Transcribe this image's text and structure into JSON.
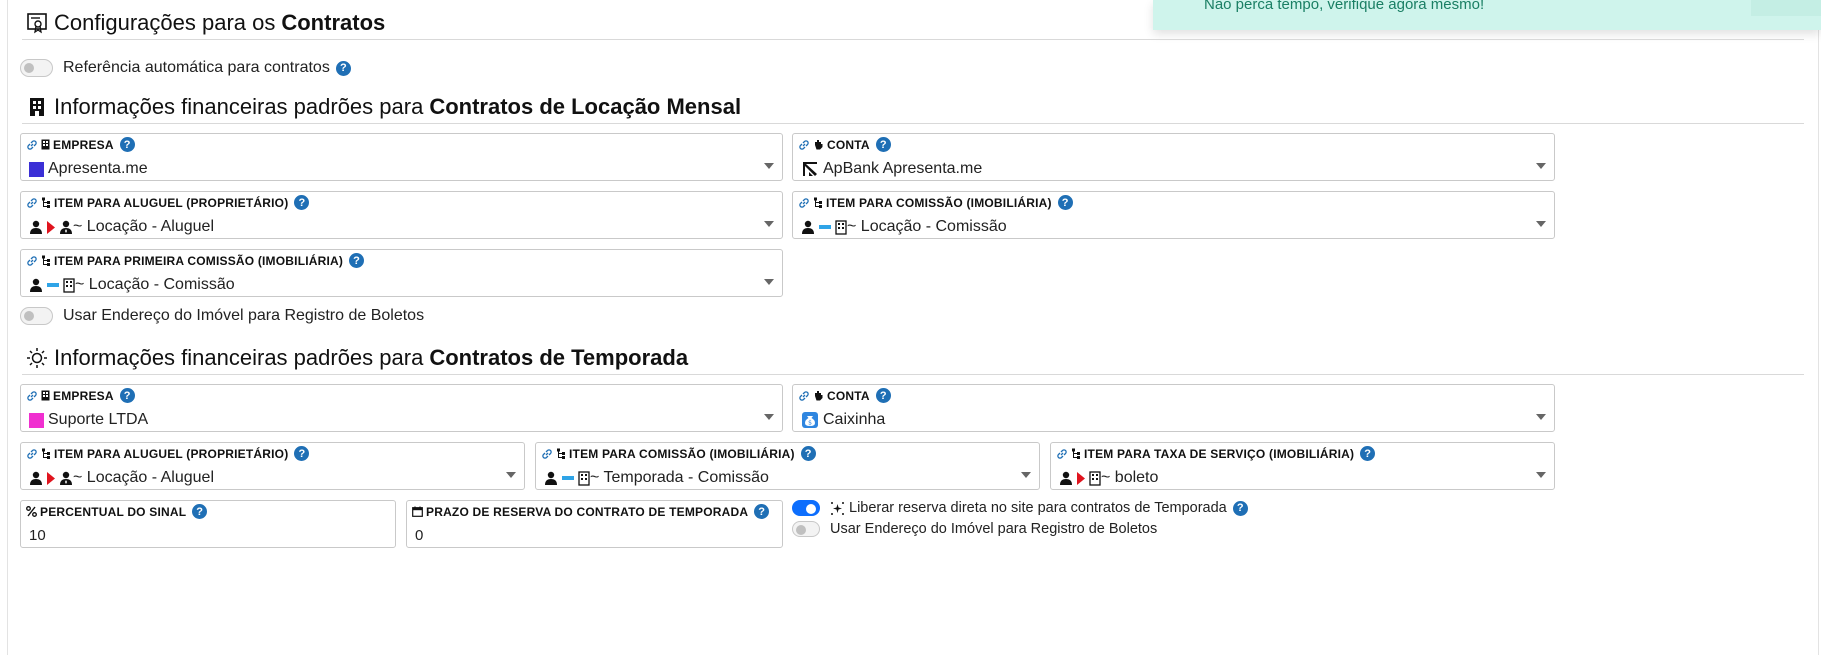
{
  "toast": {
    "message": "Não perca tempo, verifique agora mesmo!"
  },
  "contracts": {
    "title_prefix": "Configurações para os",
    "title_bold": "Contratos",
    "auto_reference_label": "Referência automática para contratos",
    "auto_reference_on": false
  },
  "monthly": {
    "title_prefix": "Informações financeiras padrões para",
    "title_bold": "Contratos de Locação Mensal",
    "empresa": {
      "label": "EMPRESA",
      "value": "Apresenta.me",
      "color": "#3b2fd6"
    },
    "conta": {
      "label": "CONTA",
      "value": "ApBank Apresenta.me"
    },
    "item_aluguel": {
      "label": "ITEM PARA ALUGUEL (PROPRIETÁRIO)",
      "value": "~ Locação - Aluguel"
    },
    "item_comissao": {
      "label": "ITEM PARA COMISSÃO (IMOBILIÁRIA)",
      "value": "~ Locação - Comissão"
    },
    "item_primeira_comissao": {
      "label": "ITEM PARA PRIMEIRA COMISSÃO (IMOBILIÁRIA)",
      "value": "~ Locação - Comissão"
    },
    "usar_endereco_label": "Usar Endereço do Imóvel para Registro de Boletos",
    "usar_endereco_on": false
  },
  "season": {
    "title_prefix": "Informações financeiras padrões para",
    "title_bold": "Contratos de Temporada",
    "empresa": {
      "label": "EMPRESA",
      "value": "Suporte LTDA",
      "color": "#f02fd0"
    },
    "conta": {
      "label": "CONTA",
      "value": "Caixinha"
    },
    "item_aluguel": {
      "label": "ITEM PARA ALUGUEL (PROPRIETÁRIO)",
      "value": "~ Locação - Aluguel"
    },
    "item_comissao": {
      "label": "ITEM PARA COMISSÃO (IMOBILIÁRIA)",
      "value": "~ Temporada - Comissão"
    },
    "item_taxa": {
      "label": "ITEM PARA TAXA DE SERVIÇO (IMOBILIÁRIA)",
      "value": "~ boleto"
    },
    "percentual": {
      "label": "PERCENTUAL DO SINAL",
      "value": "10"
    },
    "prazo": {
      "label": "PRAZO DE RESERVA DO CONTRATO DE TEMPORADA",
      "value": "0"
    },
    "liberar_label": "Liberar reserva direta no site para contratos de Temporada",
    "liberar_on": true,
    "usar_endereco_label": "Usar Endereço do Imóvel para Registro de Boletos",
    "usar_endereco_on": false
  },
  "colors": {
    "help": "#1f6fb5",
    "link": "#1f6fb5",
    "accent_red": "#e0141e",
    "accent_blue": "#2fa4e7",
    "switch_on": "#0d6efd"
  },
  "icons": [
    "certificate-icon",
    "building-icon",
    "sun-icon",
    "link-icon",
    "hand-icon",
    "sitemap-icon",
    "help-icon",
    "user-icon",
    "caret-right-icon",
    "minus-icon",
    "percent-icon",
    "calendar-icon",
    "sparkle-icon",
    "apbank-logo-icon",
    "money-bag-icon"
  ]
}
